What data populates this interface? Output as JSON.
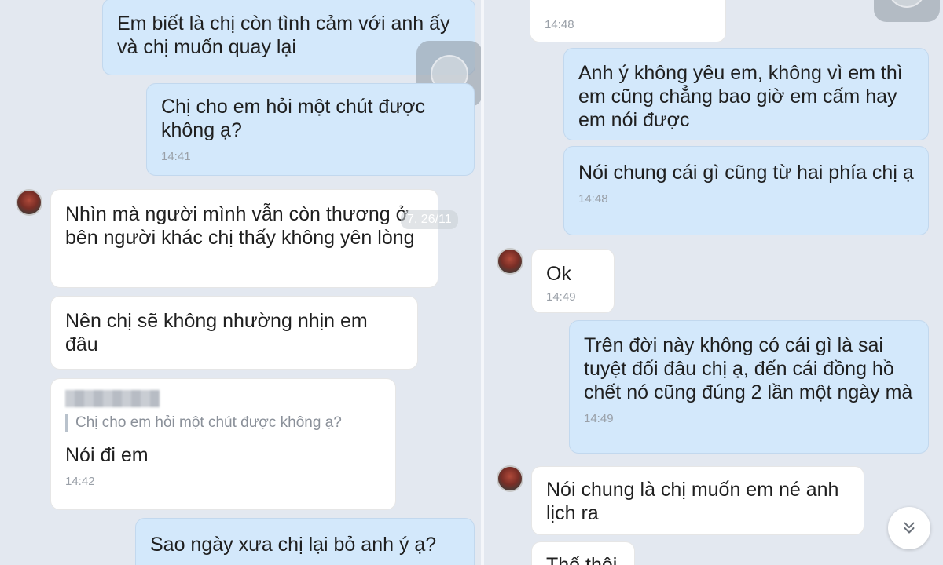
{
  "left": {
    "msg1": "Em biết là chị còn tình cảm với anh ấy và chị muốn quay lại",
    "msg2": {
      "text": "Chị cho em hỏi một chút được không ạ?",
      "time": "14:41"
    },
    "msg3": "Nhìn mà người mình vẫn còn thương ở bên người khác  chị  thấy không yên lòng",
    "overlay_timestamp": "7, 26/11",
    "msg4": "Nên chị sẽ không nhường nhịn em đâu",
    "msg5": {
      "quote": "Chị cho em hỏi một chút được không ạ?",
      "text": "Nói đi em",
      "time": "14:42"
    },
    "msg6": "Sao ngày xưa chị lại bỏ anh ý ạ?"
  },
  "right": {
    "msg0_time": "14:48",
    "msg1": "Anh ý không yêu em, không vì em thì em cũng chẳng bao giờ em cấm hay em nói được",
    "msg2": {
      "text": "Nói chung cái gì cũng từ hai phía chị ạ",
      "time": "14:48"
    },
    "msg3": {
      "text": "Ok",
      "time": "14:49"
    },
    "msg4": {
      "text": "Trên đời này không có cái gì là sai tuyệt đối đâu chị ạ, đến cái đồng hồ chết nó cũng đúng 2 lần một ngày mà",
      "time": "14:49"
    },
    "msg5": "Nói chung là chị muốn em né anh lịch ra",
    "msg6": "Thế thôi"
  },
  "icons": {
    "scroll_down": "chevron-double-down-icon",
    "avatar": "avatar"
  }
}
